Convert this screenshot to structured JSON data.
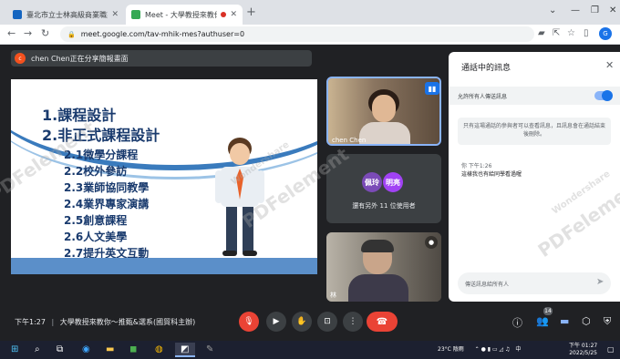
{
  "browser": {
    "tabs": [
      {
        "label": "臺北市立士林高級商業職業學校",
        "active": false
      },
      {
        "label": "Meet - 大學教授來教你～推...",
        "active": true
      }
    ],
    "url": "meet.google.com/tav-mhik-mes?authuser=0",
    "profile_initial": "G"
  },
  "meet": {
    "presenting_initial": "c",
    "presenting_text": "chen Chen正在分享簡報畫面",
    "slide": {
      "lines": [
        "1.課程設計",
        "2.非正式課程設計"
      ],
      "sublines": [
        "2.1微學分課程",
        "2.2校外參訪",
        "2.3業師協同教學",
        "2.4業界專家演講",
        "2.5創意課程",
        "2.6人文美學",
        "2.7提升英文互動"
      ]
    },
    "tiles": {
      "presenter_name": "chen Chen",
      "others_avatars": [
        "佩玲",
        "明亮"
      ],
      "others_text": "還有另外 11 位使用者",
      "cam2_name": "林"
    },
    "bottom": {
      "time": "下午1:27",
      "separator": "|",
      "meeting_title": "大學教授來教你～推甄&選系(國貿科主辦)",
      "participants_count": "14"
    }
  },
  "chat": {
    "title": "通話中的訊息",
    "allow_label": "允許所有人傳送訊息",
    "notice": "只有這場通話的參與者可以查看訊息，且訊息會在通話結束後刪除。",
    "message_header": "你  下午1:26",
    "message_text": "這樣我也有給同學看過喔",
    "input_placeholder": "傳送訊息給所有人"
  },
  "watermark": {
    "brand": "Wondershare",
    "product": "PDFelement"
  },
  "taskbar": {
    "weather": "23°C  陰雨",
    "ime": "中",
    "time": "下午 01:27",
    "date": "2022/5/25"
  }
}
